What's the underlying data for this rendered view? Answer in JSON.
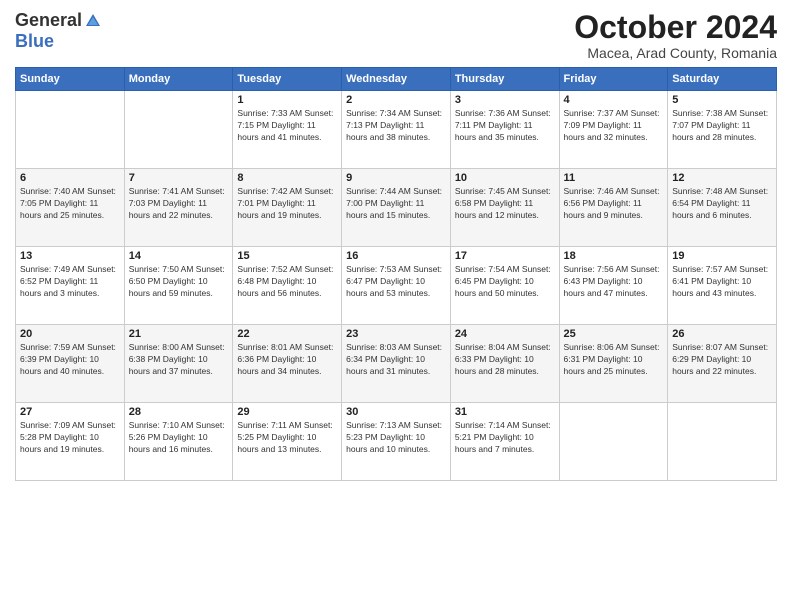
{
  "logo": {
    "general": "General",
    "blue": "Blue"
  },
  "title": "October 2024",
  "location": "Macea, Arad County, Romania",
  "days_of_week": [
    "Sunday",
    "Monday",
    "Tuesday",
    "Wednesday",
    "Thursday",
    "Friday",
    "Saturday"
  ],
  "weeks": [
    [
      {
        "day": "",
        "info": ""
      },
      {
        "day": "",
        "info": ""
      },
      {
        "day": "1",
        "info": "Sunrise: 7:33 AM\nSunset: 7:15 PM\nDaylight: 11 hours and 41 minutes."
      },
      {
        "day": "2",
        "info": "Sunrise: 7:34 AM\nSunset: 7:13 PM\nDaylight: 11 hours and 38 minutes."
      },
      {
        "day": "3",
        "info": "Sunrise: 7:36 AM\nSunset: 7:11 PM\nDaylight: 11 hours and 35 minutes."
      },
      {
        "day": "4",
        "info": "Sunrise: 7:37 AM\nSunset: 7:09 PM\nDaylight: 11 hours and 32 minutes."
      },
      {
        "day": "5",
        "info": "Sunrise: 7:38 AM\nSunset: 7:07 PM\nDaylight: 11 hours and 28 minutes."
      }
    ],
    [
      {
        "day": "6",
        "info": "Sunrise: 7:40 AM\nSunset: 7:05 PM\nDaylight: 11 hours and 25 minutes."
      },
      {
        "day": "7",
        "info": "Sunrise: 7:41 AM\nSunset: 7:03 PM\nDaylight: 11 hours and 22 minutes."
      },
      {
        "day": "8",
        "info": "Sunrise: 7:42 AM\nSunset: 7:01 PM\nDaylight: 11 hours and 19 minutes."
      },
      {
        "day": "9",
        "info": "Sunrise: 7:44 AM\nSunset: 7:00 PM\nDaylight: 11 hours and 15 minutes."
      },
      {
        "day": "10",
        "info": "Sunrise: 7:45 AM\nSunset: 6:58 PM\nDaylight: 11 hours and 12 minutes."
      },
      {
        "day": "11",
        "info": "Sunrise: 7:46 AM\nSunset: 6:56 PM\nDaylight: 11 hours and 9 minutes."
      },
      {
        "day": "12",
        "info": "Sunrise: 7:48 AM\nSunset: 6:54 PM\nDaylight: 11 hours and 6 minutes."
      }
    ],
    [
      {
        "day": "13",
        "info": "Sunrise: 7:49 AM\nSunset: 6:52 PM\nDaylight: 11 hours and 3 minutes."
      },
      {
        "day": "14",
        "info": "Sunrise: 7:50 AM\nSunset: 6:50 PM\nDaylight: 10 hours and 59 minutes."
      },
      {
        "day": "15",
        "info": "Sunrise: 7:52 AM\nSunset: 6:48 PM\nDaylight: 10 hours and 56 minutes."
      },
      {
        "day": "16",
        "info": "Sunrise: 7:53 AM\nSunset: 6:47 PM\nDaylight: 10 hours and 53 minutes."
      },
      {
        "day": "17",
        "info": "Sunrise: 7:54 AM\nSunset: 6:45 PM\nDaylight: 10 hours and 50 minutes."
      },
      {
        "day": "18",
        "info": "Sunrise: 7:56 AM\nSunset: 6:43 PM\nDaylight: 10 hours and 47 minutes."
      },
      {
        "day": "19",
        "info": "Sunrise: 7:57 AM\nSunset: 6:41 PM\nDaylight: 10 hours and 43 minutes."
      }
    ],
    [
      {
        "day": "20",
        "info": "Sunrise: 7:59 AM\nSunset: 6:39 PM\nDaylight: 10 hours and 40 minutes."
      },
      {
        "day": "21",
        "info": "Sunrise: 8:00 AM\nSunset: 6:38 PM\nDaylight: 10 hours and 37 minutes."
      },
      {
        "day": "22",
        "info": "Sunrise: 8:01 AM\nSunset: 6:36 PM\nDaylight: 10 hours and 34 minutes."
      },
      {
        "day": "23",
        "info": "Sunrise: 8:03 AM\nSunset: 6:34 PM\nDaylight: 10 hours and 31 minutes."
      },
      {
        "day": "24",
        "info": "Sunrise: 8:04 AM\nSunset: 6:33 PM\nDaylight: 10 hours and 28 minutes."
      },
      {
        "day": "25",
        "info": "Sunrise: 8:06 AM\nSunset: 6:31 PM\nDaylight: 10 hours and 25 minutes."
      },
      {
        "day": "26",
        "info": "Sunrise: 8:07 AM\nSunset: 6:29 PM\nDaylight: 10 hours and 22 minutes."
      }
    ],
    [
      {
        "day": "27",
        "info": "Sunrise: 7:09 AM\nSunset: 5:28 PM\nDaylight: 10 hours and 19 minutes."
      },
      {
        "day": "28",
        "info": "Sunrise: 7:10 AM\nSunset: 5:26 PM\nDaylight: 10 hours and 16 minutes."
      },
      {
        "day": "29",
        "info": "Sunrise: 7:11 AM\nSunset: 5:25 PM\nDaylight: 10 hours and 13 minutes."
      },
      {
        "day": "30",
        "info": "Sunrise: 7:13 AM\nSunset: 5:23 PM\nDaylight: 10 hours and 10 minutes."
      },
      {
        "day": "31",
        "info": "Sunrise: 7:14 AM\nSunset: 5:21 PM\nDaylight: 10 hours and 7 minutes."
      },
      {
        "day": "",
        "info": ""
      },
      {
        "day": "",
        "info": ""
      }
    ]
  ]
}
